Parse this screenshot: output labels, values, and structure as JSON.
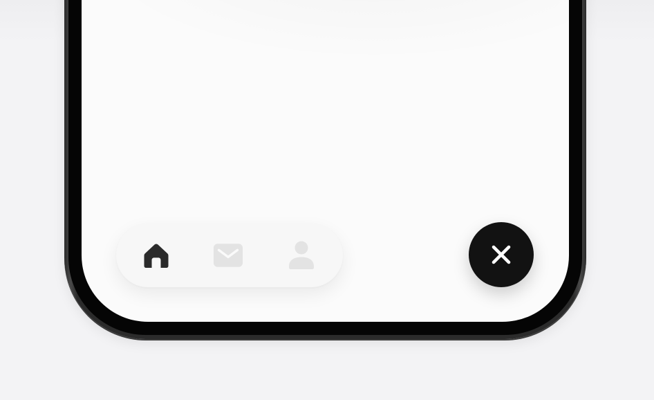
{
  "screen": {
    "background": "#fbfbfb"
  },
  "tab_bar": {
    "items": [
      {
        "id": "home",
        "icon": "home-icon",
        "active": true,
        "color": "#2b2b2b"
      },
      {
        "id": "mail",
        "icon": "mail-icon",
        "active": false,
        "color": "#e3e3e3"
      },
      {
        "id": "profile",
        "icon": "person-icon",
        "active": false,
        "color": "#e3e3e3"
      }
    ]
  },
  "fab": {
    "icon": "close-icon",
    "background": "#121212",
    "icon_color": "#ffffff"
  },
  "colors": {
    "page_background": "#f3f3f5",
    "frame": "#2b2b2b",
    "active_icon": "#2b2b2b",
    "inactive_icon": "#e3e3e3"
  }
}
